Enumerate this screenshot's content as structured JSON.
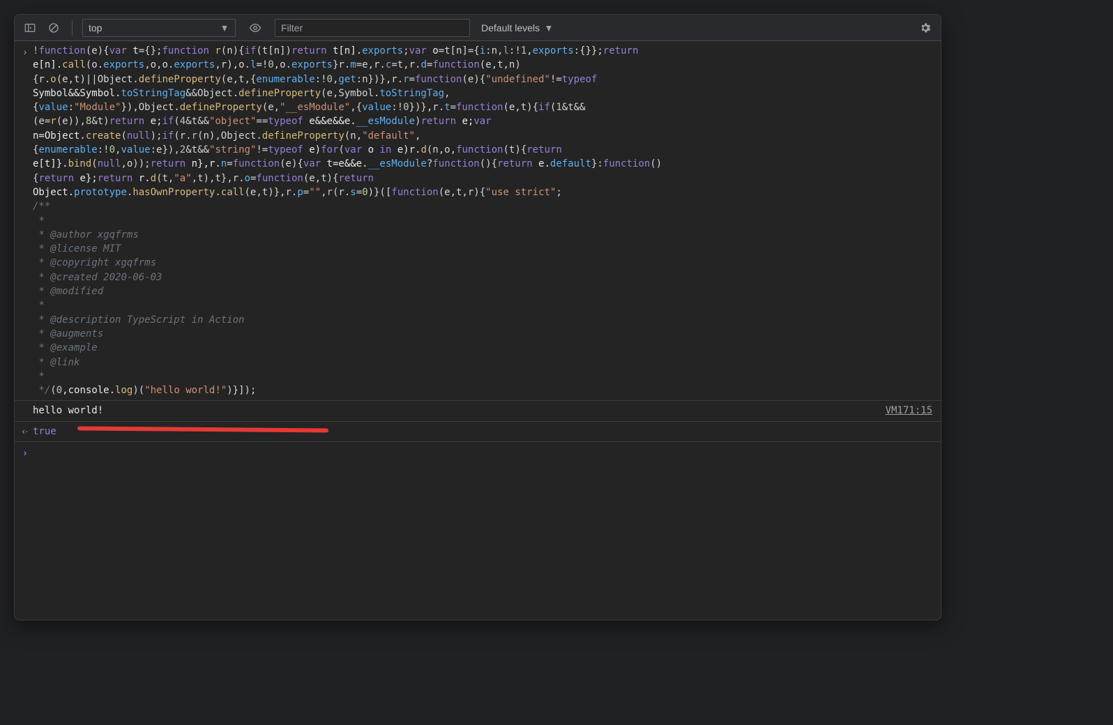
{
  "toolbar": {
    "context": "top",
    "filter_placeholder": "Filter",
    "levels_label": "Default levels"
  },
  "code": {
    "segments": [
      {
        "t": "!",
        "c": "bang"
      },
      {
        "t": "function",
        "c": "kw"
      },
      {
        "t": "(e){",
        "c": "pn"
      },
      {
        "t": "var ",
        "c": "kw"
      },
      {
        "t": "t",
        "c": "id"
      },
      {
        "t": "={};",
        "c": "pn"
      },
      {
        "t": "function ",
        "c": "kw"
      },
      {
        "t": "r",
        "c": "fn"
      },
      {
        "t": "(n){",
        "c": "pn"
      },
      {
        "t": "if",
        "c": "kw"
      },
      {
        "t": "(t[n])",
        "c": "pn"
      },
      {
        "t": "return ",
        "c": "kw"
      },
      {
        "t": "t[n].",
        "c": "id"
      },
      {
        "t": "exports",
        "c": "prop"
      },
      {
        "t": ";",
        "c": "pn"
      },
      {
        "t": "var ",
        "c": "kw"
      },
      {
        "t": "o",
        "c": "id"
      },
      {
        "t": "=t[n]={",
        "c": "pn"
      },
      {
        "t": "i",
        "c": "prop"
      },
      {
        "t": ":n,",
        "c": "pn"
      },
      {
        "t": "l",
        "c": "prop"
      },
      {
        "t": ":!",
        "c": "pn"
      },
      {
        "t": "1",
        "c": "num"
      },
      {
        "t": ",",
        "c": "pn"
      },
      {
        "t": "exports",
        "c": "prop"
      },
      {
        "t": ":{}};",
        "c": "pn"
      },
      {
        "t": "return\n",
        "c": "kw"
      },
      {
        "t": "e[n].",
        "c": "id"
      },
      {
        "t": "call",
        "c": "fn"
      },
      {
        "t": "(o.",
        "c": "pn"
      },
      {
        "t": "exports",
        "c": "prop"
      },
      {
        "t": ",o,o.",
        "c": "pn"
      },
      {
        "t": "exports",
        "c": "prop"
      },
      {
        "t": ",r),o.",
        "c": "pn"
      },
      {
        "t": "l",
        "c": "prop"
      },
      {
        "t": "=!",
        "c": "pn"
      },
      {
        "t": "0",
        "c": "num"
      },
      {
        "t": ",o.",
        "c": "pn"
      },
      {
        "t": "exports",
        "c": "prop"
      },
      {
        "t": "}r.",
        "c": "pn"
      },
      {
        "t": "m",
        "c": "prop"
      },
      {
        "t": "=e,r.",
        "c": "pn"
      },
      {
        "t": "c",
        "c": "prop"
      },
      {
        "t": "=t,r.",
        "c": "pn"
      },
      {
        "t": "d",
        "c": "prop"
      },
      {
        "t": "=",
        "c": "pn"
      },
      {
        "t": "function",
        "c": "kw"
      },
      {
        "t": "(e,t,n)\n",
        "c": "pn"
      },
      {
        "t": "{r.",
        "c": "pn"
      },
      {
        "t": "o",
        "c": "fn"
      },
      {
        "t": "(e,t)||Object.",
        "c": "pn"
      },
      {
        "t": "defineProperty",
        "c": "fn"
      },
      {
        "t": "(e,t,{",
        "c": "pn"
      },
      {
        "t": "enumerable",
        "c": "prop"
      },
      {
        "t": ":!",
        "c": "pn"
      },
      {
        "t": "0",
        "c": "num"
      },
      {
        "t": ",",
        "c": "pn"
      },
      {
        "t": "get",
        "c": "prop"
      },
      {
        "t": ":n})},r.",
        "c": "pn"
      },
      {
        "t": "r",
        "c": "prop"
      },
      {
        "t": "=",
        "c": "pn"
      },
      {
        "t": "function",
        "c": "kw"
      },
      {
        "t": "(e){",
        "c": "pn"
      },
      {
        "t": "\"undefined\"",
        "c": "str"
      },
      {
        "t": "!=",
        "c": "pn"
      },
      {
        "t": "typeof\n",
        "c": "kw"
      },
      {
        "t": "Symbol&&Symbol.",
        "c": "id"
      },
      {
        "t": "toStringTag",
        "c": "prop"
      },
      {
        "t": "&&Object.",
        "c": "pn"
      },
      {
        "t": "defineProperty",
        "c": "fn"
      },
      {
        "t": "(e,Symbol.",
        "c": "pn"
      },
      {
        "t": "toStringTag",
        "c": "prop"
      },
      {
        "t": ",\n",
        "c": "pn"
      },
      {
        "t": "{",
        "c": "pn"
      },
      {
        "t": "value",
        "c": "prop"
      },
      {
        "t": ":",
        "c": "pn"
      },
      {
        "t": "\"Module\"",
        "c": "str"
      },
      {
        "t": "}),Object.",
        "c": "pn"
      },
      {
        "t": "defineProperty",
        "c": "fn"
      },
      {
        "t": "(e,",
        "c": "pn"
      },
      {
        "t": "\"__esModule\"",
        "c": "str"
      },
      {
        "t": ",{",
        "c": "pn"
      },
      {
        "t": "value",
        "c": "prop"
      },
      {
        "t": ":!",
        "c": "pn"
      },
      {
        "t": "0",
        "c": "num"
      },
      {
        "t": "})},r.",
        "c": "pn"
      },
      {
        "t": "t",
        "c": "prop"
      },
      {
        "t": "=",
        "c": "pn"
      },
      {
        "t": "function",
        "c": "kw"
      },
      {
        "t": "(e,t){",
        "c": "pn"
      },
      {
        "t": "if",
        "c": "kw"
      },
      {
        "t": "(",
        "c": "pn"
      },
      {
        "t": "1",
        "c": "num"
      },
      {
        "t": "&t&&\n",
        "c": "pn"
      },
      {
        "t": "(e=",
        "c": "pn"
      },
      {
        "t": "r",
        "c": "fn"
      },
      {
        "t": "(e)),",
        "c": "pn"
      },
      {
        "t": "8",
        "c": "num"
      },
      {
        "t": "&t)",
        "c": "pn"
      },
      {
        "t": "return ",
        "c": "kw"
      },
      {
        "t": "e;",
        "c": "id"
      },
      {
        "t": "if",
        "c": "kw"
      },
      {
        "t": "(",
        "c": "pn"
      },
      {
        "t": "4",
        "c": "num"
      },
      {
        "t": "&t&&",
        "c": "pn"
      },
      {
        "t": "\"object\"",
        "c": "str"
      },
      {
        "t": "==",
        "c": "pn"
      },
      {
        "t": "typeof ",
        "c": "kw"
      },
      {
        "t": "e&&e&&e.",
        "c": "id"
      },
      {
        "t": "__esModule",
        "c": "prop"
      },
      {
        "t": ")",
        "c": "pn"
      },
      {
        "t": "return ",
        "c": "kw"
      },
      {
        "t": "e;",
        "c": "id"
      },
      {
        "t": "var\n",
        "c": "kw"
      },
      {
        "t": "n=Object.",
        "c": "id"
      },
      {
        "t": "create",
        "c": "fn"
      },
      {
        "t": "(",
        "c": "pn"
      },
      {
        "t": "null",
        "c": "kw"
      },
      {
        "t": ");",
        "c": "pn"
      },
      {
        "t": "if",
        "c": "kw"
      },
      {
        "t": "(r.",
        "c": "pn"
      },
      {
        "t": "r",
        "c": "fn"
      },
      {
        "t": "(n),Object.",
        "c": "pn"
      },
      {
        "t": "defineProperty",
        "c": "fn"
      },
      {
        "t": "(n,",
        "c": "pn"
      },
      {
        "t": "\"default\"",
        "c": "str"
      },
      {
        "t": ",\n",
        "c": "pn"
      },
      {
        "t": "{",
        "c": "pn"
      },
      {
        "t": "enumerable",
        "c": "prop"
      },
      {
        "t": ":!",
        "c": "pn"
      },
      {
        "t": "0",
        "c": "num"
      },
      {
        "t": ",",
        "c": "pn"
      },
      {
        "t": "value",
        "c": "prop"
      },
      {
        "t": ":e}),",
        "c": "pn"
      },
      {
        "t": "2",
        "c": "num"
      },
      {
        "t": "&t&&",
        "c": "pn"
      },
      {
        "t": "\"string\"",
        "c": "str"
      },
      {
        "t": "!=",
        "c": "pn"
      },
      {
        "t": "typeof ",
        "c": "kw"
      },
      {
        "t": "e)",
        "c": "id"
      },
      {
        "t": "for",
        "c": "kw"
      },
      {
        "t": "(",
        "c": "pn"
      },
      {
        "t": "var ",
        "c": "kw"
      },
      {
        "t": "o ",
        "c": "id"
      },
      {
        "t": "in ",
        "c": "kw"
      },
      {
        "t": "e)r.",
        "c": "id"
      },
      {
        "t": "d",
        "c": "fn"
      },
      {
        "t": "(n,o,",
        "c": "pn"
      },
      {
        "t": "function",
        "c": "kw"
      },
      {
        "t": "(t){",
        "c": "pn"
      },
      {
        "t": "return\n",
        "c": "kw"
      },
      {
        "t": "e[t]}.",
        "c": "id"
      },
      {
        "t": "bind",
        "c": "fn"
      },
      {
        "t": "(",
        "c": "pn"
      },
      {
        "t": "null",
        "c": "kw"
      },
      {
        "t": ",o));",
        "c": "pn"
      },
      {
        "t": "return ",
        "c": "kw"
      },
      {
        "t": "n},r.",
        "c": "id"
      },
      {
        "t": "n",
        "c": "prop"
      },
      {
        "t": "=",
        "c": "pn"
      },
      {
        "t": "function",
        "c": "kw"
      },
      {
        "t": "(e){",
        "c": "pn"
      },
      {
        "t": "var ",
        "c": "kw"
      },
      {
        "t": "t=e&&e.",
        "c": "id"
      },
      {
        "t": "__esModule",
        "c": "prop"
      },
      {
        "t": "?",
        "c": "pn"
      },
      {
        "t": "function",
        "c": "kw"
      },
      {
        "t": "(){",
        "c": "pn"
      },
      {
        "t": "return ",
        "c": "kw"
      },
      {
        "t": "e.",
        "c": "id"
      },
      {
        "t": "default",
        "c": "prop"
      },
      {
        "t": "}:",
        "c": "pn"
      },
      {
        "t": "function",
        "c": "kw"
      },
      {
        "t": "()\n",
        "c": "pn"
      },
      {
        "t": "{",
        "c": "pn"
      },
      {
        "t": "return ",
        "c": "kw"
      },
      {
        "t": "e};",
        "c": "id"
      },
      {
        "t": "return ",
        "c": "kw"
      },
      {
        "t": "r.",
        "c": "id"
      },
      {
        "t": "d",
        "c": "fn"
      },
      {
        "t": "(t,",
        "c": "pn"
      },
      {
        "t": "\"a\"",
        "c": "str"
      },
      {
        "t": ",t),t},r.",
        "c": "pn"
      },
      {
        "t": "o",
        "c": "prop"
      },
      {
        "t": "=",
        "c": "pn"
      },
      {
        "t": "function",
        "c": "kw"
      },
      {
        "t": "(e,t){",
        "c": "pn"
      },
      {
        "t": "return\n",
        "c": "kw"
      },
      {
        "t": "Object.",
        "c": "id"
      },
      {
        "t": "prototype",
        "c": "prop"
      },
      {
        "t": ".",
        "c": "pn"
      },
      {
        "t": "hasOwnProperty",
        "c": "fn"
      },
      {
        "t": ".",
        "c": "pn"
      },
      {
        "t": "call",
        "c": "fn"
      },
      {
        "t": "(e,t)},r.",
        "c": "pn"
      },
      {
        "t": "p",
        "c": "prop"
      },
      {
        "t": "=",
        "c": "pn"
      },
      {
        "t": "\"\"",
        "c": "str"
      },
      {
        "t": ",",
        "c": "pn"
      },
      {
        "t": "r",
        "c": "fn"
      },
      {
        "t": "(r.",
        "c": "pn"
      },
      {
        "t": "s",
        "c": "prop"
      },
      {
        "t": "=",
        "c": "pn"
      },
      {
        "t": "0",
        "c": "num"
      },
      {
        "t": ")}([",
        "c": "pn"
      },
      {
        "t": "function",
        "c": "kw"
      },
      {
        "t": "(e,t,r){",
        "c": "pn"
      },
      {
        "t": "\"use strict\"",
        "c": "str"
      },
      {
        "t": ";\n",
        "c": "pn"
      },
      {
        "t": "/**\n *\n * @author xgqfrms\n * @license MIT\n * @copyright xgqfrms\n * @created 2020-06-03\n * @modified\n *\n * @description TypeScript in Action\n * @augments\n * @example\n * @link\n *\n */",
        "c": "cm"
      },
      {
        "t": "(",
        "c": "pn"
      },
      {
        "t": "0",
        "c": "num"
      },
      {
        "t": ",console.",
        "c": "id"
      },
      {
        "t": "log",
        "c": "fn"
      },
      {
        "t": ")(",
        "c": "pn"
      },
      {
        "t": "\"hello world!\"",
        "c": "str"
      },
      {
        "t": ")}]);",
        "c": "pn"
      }
    ]
  },
  "log_output": "hello world!",
  "source_link": "VM171:15",
  "return_value": "true"
}
